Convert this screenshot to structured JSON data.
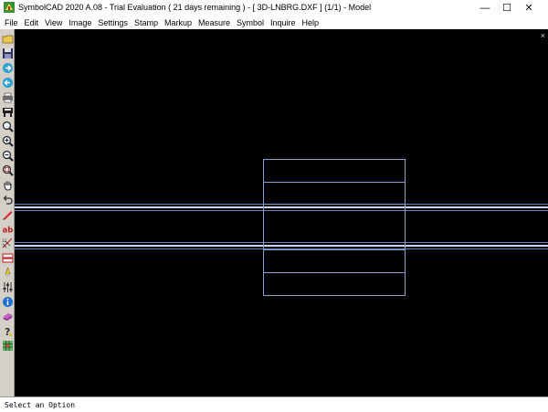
{
  "window": {
    "title": "SymbolCAD 2020 A.08 - Trial Evaluation ( 21 days remaining ) - [ 3D-LNBRG.DXF ] (1/1) - Model",
    "minimize_glyph": "—",
    "maximize_glyph": "☐",
    "close_glyph": "✕"
  },
  "menu": [
    "File",
    "Edit",
    "View",
    "Image",
    "Settings",
    "Stamp",
    "Markup",
    "Measure",
    "Symbol",
    "Inquire",
    "Help"
  ],
  "toolbar": [
    {
      "name": "open-icon"
    },
    {
      "name": "save-icon"
    },
    {
      "name": "forward-arrow-icon"
    },
    {
      "name": "back-arrow-icon"
    },
    {
      "name": "print-icon"
    },
    {
      "name": "plotter-icon"
    },
    {
      "name": "zoom-icon"
    },
    {
      "name": "zoom-in-icon"
    },
    {
      "name": "zoom-out-icon"
    },
    {
      "name": "zoom-window-icon"
    },
    {
      "name": "pan-hand-icon"
    },
    {
      "name": "undo-icon"
    },
    {
      "name": "pencil-icon"
    },
    {
      "name": "text-ab-icon"
    },
    {
      "name": "dimension-icon"
    },
    {
      "name": "layers-icon"
    },
    {
      "name": "highlight-icon"
    },
    {
      "name": "adjust-icon"
    },
    {
      "name": "info-icon"
    },
    {
      "name": "book-icon"
    },
    {
      "name": "help-icon"
    },
    {
      "name": "grid-icon"
    }
  ],
  "canvas": {
    "background": "#000000",
    "line_color": "#8aa0c8",
    "highlight_color": "#d8e4ff",
    "close_glyph": "×"
  },
  "status": {
    "text": "Select an Option"
  }
}
